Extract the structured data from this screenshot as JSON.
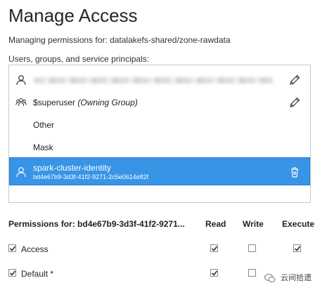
{
  "page": {
    "title": "Manage Access",
    "managing_text": "Managing permissions for: datalakefs-shared/zone-rawdata",
    "principals_label": "Users, groups, and service principals:"
  },
  "principals": [
    {
      "type": "user",
      "name": "",
      "blurred": true,
      "editable": true
    },
    {
      "type": "group",
      "name": "$superuser",
      "suffix": "(Owning Group)",
      "editable": true
    },
    {
      "type": "none",
      "name": "Other"
    },
    {
      "type": "none",
      "name": "Mask"
    },
    {
      "type": "user",
      "name": "spark-cluster-identity",
      "id": "bd4e67b9-3d3f-41f2-9271-2c5e0614e82f",
      "selected": true,
      "deletable": true
    }
  ],
  "permissions": {
    "header_label": "Permissions for: bd4e67b9-3d3f-41f2-9271...",
    "columns": [
      "Read",
      "Write",
      "Execute"
    ],
    "rows": [
      {
        "label": "Access",
        "enabled": true,
        "read": true,
        "write": false,
        "execute": true
      },
      {
        "label": "Default *",
        "enabled": true,
        "read": true,
        "write": false,
        "execute": false
      }
    ]
  },
  "watermark": {
    "text": "云间拾遗"
  },
  "colors": {
    "selected_bg": "#3794e6",
    "border": "#c8c8c8"
  }
}
